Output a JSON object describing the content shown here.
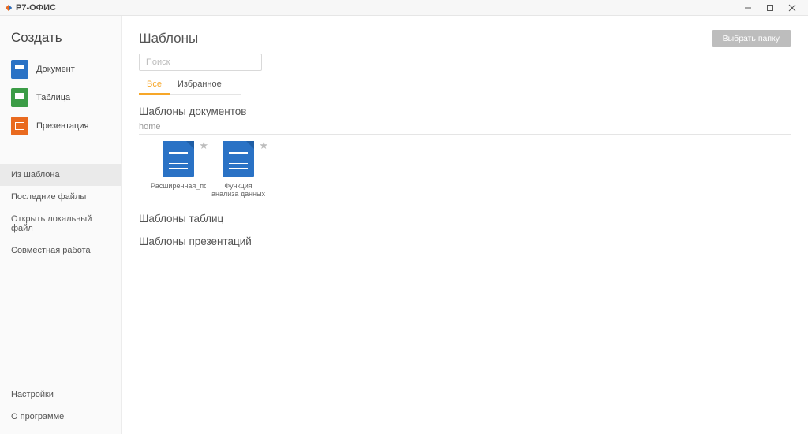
{
  "titlebar": {
    "app_name": "Р7-ОФИС"
  },
  "sidebar": {
    "create_heading": "Создать",
    "create": {
      "document": "Документ",
      "table": "Таблица",
      "presentation": "Презентация"
    },
    "nav": {
      "from_template": "Из шаблона",
      "recent_files": "Последние файлы",
      "open_local": "Открыть локальный файл",
      "collaboration": "Совместная работа"
    },
    "bottom": {
      "settings": "Настройки",
      "about": "О программе"
    }
  },
  "main": {
    "title": "Шаблоны",
    "choose_folder": "Выбрать папку",
    "search_placeholder": "Поиск",
    "tabs": {
      "all": "Все",
      "favorites": "Избранное"
    },
    "sections": {
      "documents_title": "Шаблоны документов",
      "breadcrumb": "home",
      "tables_title": "Шаблоны таблиц",
      "presentations_title": "Шаблоны презентаций"
    },
    "document_templates": [
      {
        "name": "Расширенная_пользовательская..."
      },
      {
        "name": "Функция анализа данных"
      }
    ]
  }
}
